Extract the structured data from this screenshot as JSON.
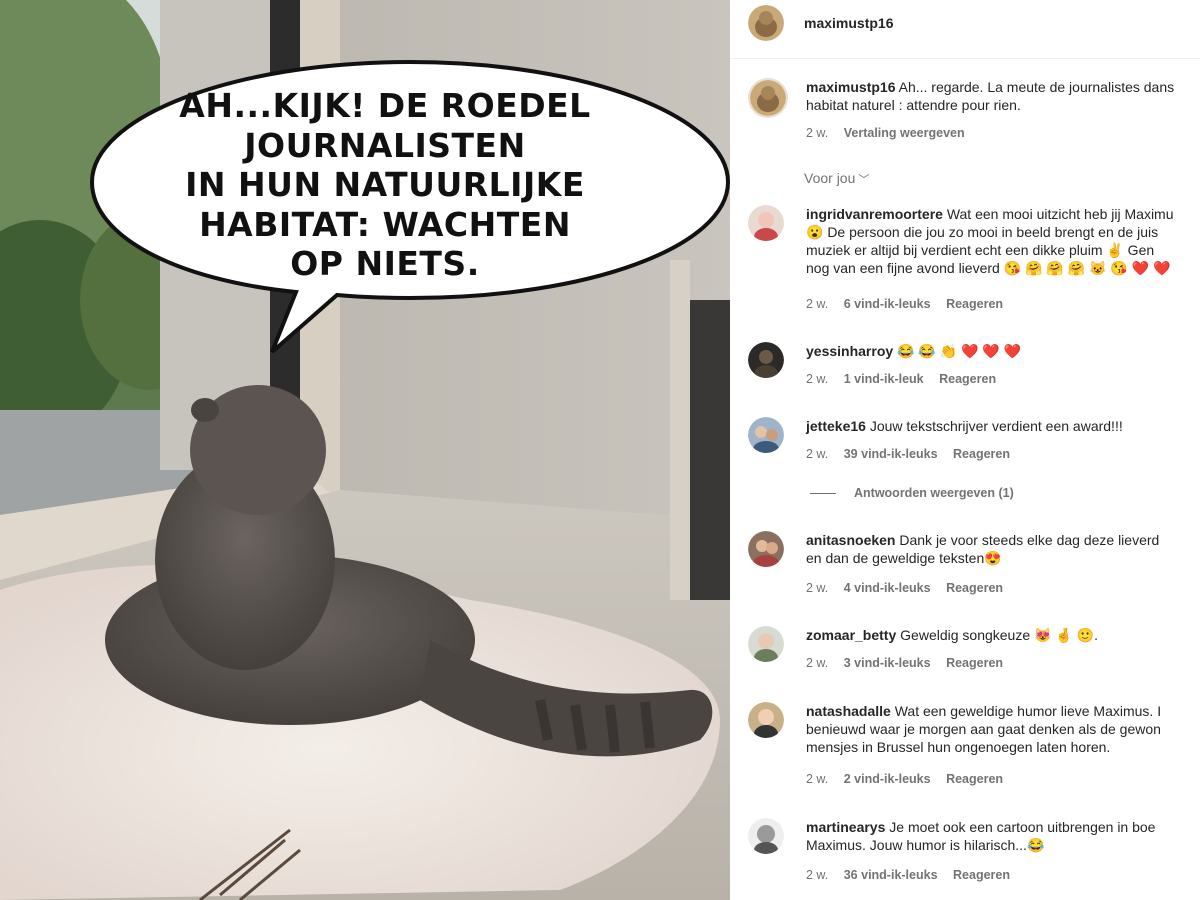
{
  "speech_bubble": {
    "lines": [
      "AH...KIJK! DE ROEDEL",
      "JOURNALISTEN",
      "IN HUN NATUURLIJKE",
      "HABITAT: WACHTEN",
      "OP NIETS."
    ]
  },
  "post": {
    "username": "maximustp16",
    "caption": {
      "username": "maximustp16",
      "line1": "Ah... regarde. La meute de journalistes dans",
      "line2": "habitat naturel : attendre pour rien.",
      "time": "2 w.",
      "translate": "Vertaling weergeven"
    }
  },
  "sort_label": "Voor jou",
  "reply_label": "Reageren",
  "comments": [
    {
      "username": "ingridvanremoortere",
      "line1": "Wat een mooi uitzicht heb jij Maximu",
      "line2": "😮 De persoon die jou zo mooi in beeld brengt en de juis",
      "line3": "muziek er altijd bij verdient echt een dikke pluim ✌️ Gen",
      "line4": "nog van een fijne avond lieverd 😘 🤗 🤗 🤗 😺 😘 ❤️ ❤️",
      "time": "2 w.",
      "likes": "6 vind-ik-leuks"
    },
    {
      "username": "yessinharroy",
      "line1": "😂 😂 👏 ❤️ ❤️ ❤️",
      "time": "2 w.",
      "likes": "1 vind-ik-leuk"
    },
    {
      "username": "jetteke16",
      "line1": "Jouw tekstschrijver verdient een award!!!",
      "time": "2 w.",
      "likes": "39 vind-ik-leuks",
      "view_replies": "Antwoorden weergeven (1)"
    },
    {
      "username": "anitasnoeken",
      "line1": "Dank je voor steeds elke dag deze lieverd",
      "line2": "en dan de geweldige teksten😍",
      "time": "2 w.",
      "likes": "4 vind-ik-leuks"
    },
    {
      "username": "zomaar_betty",
      "line1": "Geweldig songkeuze 😻 🤞 🙂.",
      "time": "2 w.",
      "likes": "3 vind-ik-leuks"
    },
    {
      "username": "natashadalle",
      "line1": "Wat een geweldige humor lieve Maximus. I",
      "line2": "benieuwd waar je morgen aan gaat denken als de gewon",
      "line3": "mensjes in Brussel hun ongenoegen laten horen.",
      "time": "2 w.",
      "likes": "2 vind-ik-leuks"
    },
    {
      "username": "martinearys",
      "line1": "Je moet ook een cartoon uitbrengen in boe",
      "line2": "Maximus. Jouw humor is hilarisch...😂",
      "time": "2 w.",
      "likes": "36 vind-ik-leuks"
    }
  ]
}
